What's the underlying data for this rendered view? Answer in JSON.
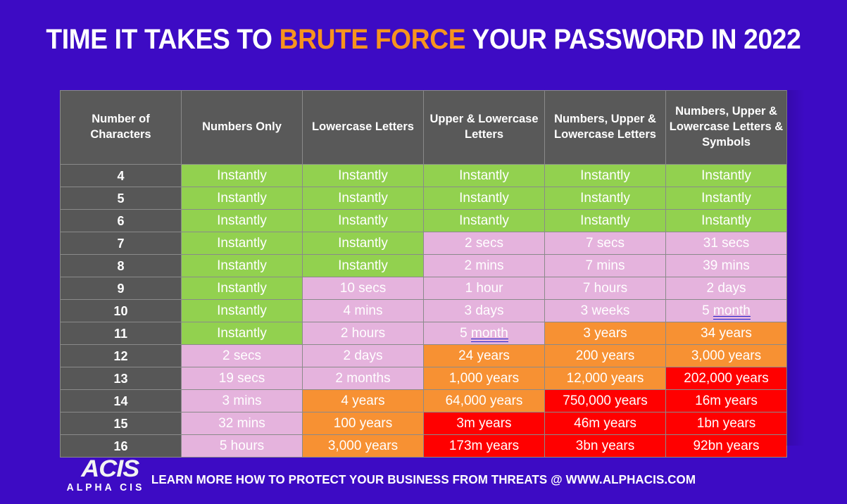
{
  "title": {
    "part1": "TIME IT TAKES TO ",
    "accent": "BRUTE FORCE",
    "part2": " YOUR PASSWORD IN 2022"
  },
  "colors": {
    "background": "#3D0BC4",
    "accent_orange": "#F7941E",
    "header_gray": "#595959",
    "row_label_gray": "#575757",
    "green": "#92D14F",
    "pink": "#E5B3DD",
    "orange": "#F79133",
    "red": "#FF0000",
    "text": "#FFFFFF",
    "gridline": "#8A8A8A"
  },
  "table": {
    "headers": [
      "Number of Characters",
      "Numbers Only",
      "Lowercase Letters",
      "Upper & Lowercase Letters",
      "Numbers, Upper & Lowercase Letters",
      "Numbers, Upper & Lowercase Letters & Symbols"
    ],
    "rows": [
      {
        "characters": "4",
        "cells": [
          {
            "text": "Instantly",
            "color": "green"
          },
          {
            "text": "Instantly",
            "color": "green"
          },
          {
            "text": "Instantly",
            "color": "green"
          },
          {
            "text": "Instantly",
            "color": "green"
          },
          {
            "text": "Instantly",
            "color": "green"
          }
        ]
      },
      {
        "characters": "5",
        "cells": [
          {
            "text": "Instantly",
            "color": "green"
          },
          {
            "text": "Instantly",
            "color": "green"
          },
          {
            "text": "Instantly",
            "color": "green"
          },
          {
            "text": "Instantly",
            "color": "green"
          },
          {
            "text": "Instantly",
            "color": "green"
          }
        ]
      },
      {
        "characters": "6",
        "cells": [
          {
            "text": "Instantly",
            "color": "green"
          },
          {
            "text": "Instantly",
            "color": "green"
          },
          {
            "text": "Instantly",
            "color": "green"
          },
          {
            "text": "Instantly",
            "color": "green"
          },
          {
            "text": "Instantly",
            "color": "green"
          }
        ]
      },
      {
        "characters": "7",
        "cells": [
          {
            "text": "Instantly",
            "color": "green"
          },
          {
            "text": "Instantly",
            "color": "green"
          },
          {
            "text": "2 secs",
            "color": "pink"
          },
          {
            "text": "7 secs",
            "color": "pink"
          },
          {
            "text": "31 secs",
            "color": "pink"
          }
        ]
      },
      {
        "characters": "8",
        "cells": [
          {
            "text": "Instantly",
            "color": "green"
          },
          {
            "text": "Instantly",
            "color": "green"
          },
          {
            "text": "2 mins",
            "color": "pink"
          },
          {
            "text": "7 mins",
            "color": "pink"
          },
          {
            "text": "39 mins",
            "color": "pink"
          }
        ]
      },
      {
        "characters": "9",
        "cells": [
          {
            "text": "Instantly",
            "color": "green"
          },
          {
            "text": "10 secs",
            "color": "pink"
          },
          {
            "text": "1 hour",
            "color": "pink"
          },
          {
            "text": "7 hours",
            "color": "pink"
          },
          {
            "text": "2 days",
            "color": "pink"
          }
        ]
      },
      {
        "characters": "10",
        "cells": [
          {
            "text": "Instantly",
            "color": "green"
          },
          {
            "text": "4 mins",
            "color": "pink"
          },
          {
            "text": "3 days",
            "color": "pink"
          },
          {
            "text": "3 weeks",
            "color": "pink"
          },
          {
            "text": "5 month",
            "color": "pink",
            "spell_word": "month",
            "prefix": "5 "
          }
        ]
      },
      {
        "characters": "11",
        "cells": [
          {
            "text": "Instantly",
            "color": "green"
          },
          {
            "text": "2 hours",
            "color": "pink"
          },
          {
            "text": "5 month",
            "color": "pink",
            "spell_word": "month",
            "prefix": "5 "
          },
          {
            "text": "3 years",
            "color": "orange"
          },
          {
            "text": "34 years",
            "color": "orange"
          }
        ]
      },
      {
        "characters": "12",
        "cells": [
          {
            "text": "2 secs",
            "color": "pink"
          },
          {
            "text": "2 days",
            "color": "pink"
          },
          {
            "text": "24 years",
            "color": "orange"
          },
          {
            "text": "200 years",
            "color": "orange"
          },
          {
            "text": "3,000 years",
            "color": "orange"
          }
        ]
      },
      {
        "characters": "13",
        "cells": [
          {
            "text": "19 secs",
            "color": "pink"
          },
          {
            "text": "2 months",
            "color": "pink"
          },
          {
            "text": "1,000 years",
            "color": "orange"
          },
          {
            "text": "12,000 years",
            "color": "orange"
          },
          {
            "text": "202,000 years",
            "color": "red"
          }
        ]
      },
      {
        "characters": "14",
        "cells": [
          {
            "text": "3 mins",
            "color": "pink"
          },
          {
            "text": "4 years",
            "color": "orange"
          },
          {
            "text": "64,000 years",
            "color": "orange"
          },
          {
            "text": "750,000 years",
            "color": "red"
          },
          {
            "text": "16m years",
            "color": "red"
          }
        ]
      },
      {
        "characters": "15",
        "cells": [
          {
            "text": "32 mins",
            "color": "pink"
          },
          {
            "text": "100 years",
            "color": "orange"
          },
          {
            "text": "3m years",
            "color": "red"
          },
          {
            "text": "46m years",
            "color": "red"
          },
          {
            "text": "1bn years",
            "color": "red"
          }
        ]
      },
      {
        "characters": "16",
        "cells": [
          {
            "text": "5 hours",
            "color": "pink"
          },
          {
            "text": "3,000 years",
            "color": "orange"
          },
          {
            "text": "173m years",
            "color": "red"
          },
          {
            "text": "3bn years",
            "color": "red"
          },
          {
            "text": "92bn years",
            "color": "red"
          }
        ]
      }
    ]
  },
  "footer": {
    "logo_mark": "ACIS",
    "logo_sub": "ALPHA CIS",
    "tagline": "LEARN MORE HOW TO PROTECT YOUR BUSINESS FROM THREATS @ WWW.ALPHACIS.COM"
  }
}
